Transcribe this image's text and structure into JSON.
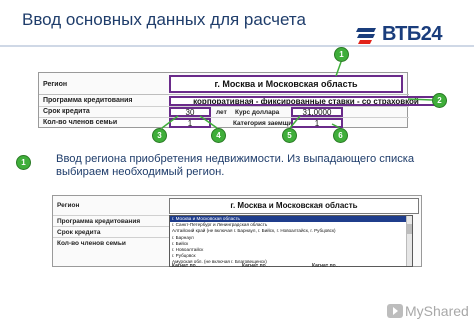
{
  "header": {
    "title": "Ввод основных данных для расчета",
    "logo_text": "ВТБ24"
  },
  "form1": {
    "region_label": "Регион",
    "region_value": "г. Москва и Московская область",
    "program_label": "Программа кредитования",
    "program_value": "корпоративная - фиксированные ставки - со страховкой",
    "term_label": "Срок кредита",
    "term_value": "30",
    "term_unit": "лет",
    "rate_label": "Курс доллара",
    "rate_value": "31,0000",
    "family_label": "Кол-во членов семьи",
    "family_value": "1",
    "category_label": "Категория заемщика",
    "category_value": "1"
  },
  "callouts": {
    "c1": "1",
    "c2": "2",
    "c3": "3",
    "c4": "4",
    "c5": "5",
    "c6": "6",
    "desc_badge": "1"
  },
  "description": {
    "text": "Ввод региона приобретения недвижимости. Из выпадающего списка выбираем необходимый регион."
  },
  "form2": {
    "region_label": "Регион",
    "region_value": "г. Москва и Московская область",
    "program_label": "Программа кредитования",
    "term_label": "Срок кредита",
    "family_label": "Кол-во членов семьи",
    "dropdown_items": [
      "г. Москва и Московская область",
      "г. Санкт-Петербург и Ленинградская область",
      "Алтайский край (не включая г. Барнаул, г. Бийск, г. Новоалтайск, г. Рубцовск)",
      "г. Барнаул",
      "г. Бийск",
      "г. Новоалтайск",
      "г. Рубцовск",
      "Амурская обл. (не включая г. Благовещенск)"
    ],
    "bottom_cells": [
      "Кагнат по...",
      "Кагнат по...",
      "Кагнат по..."
    ]
  },
  "watermark": {
    "text": "MyShared"
  },
  "colors": {
    "title": "#1f3d6b",
    "callout_green": "#3fae3a",
    "highlight_border": "#6a2b8a",
    "dropdown_selected": "#1f3d8c"
  }
}
